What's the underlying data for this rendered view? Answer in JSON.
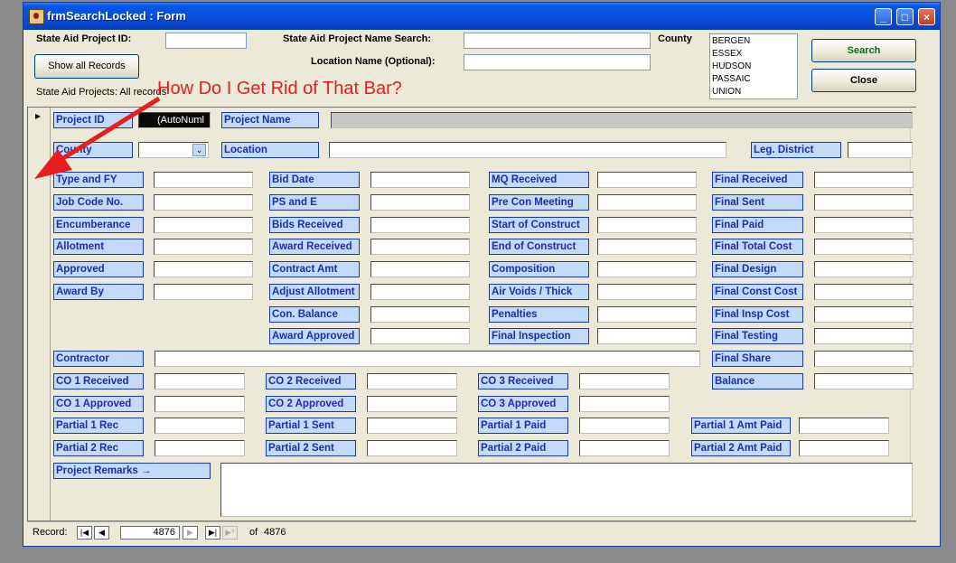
{
  "window": {
    "title": "frmSearchLocked : Form"
  },
  "header": {
    "project_id_label": "State Aid Project ID:",
    "project_name_search_label": "State Aid Project Name Search:",
    "location_label": "Location Name (Optional):",
    "county_label": "County",
    "show_all_label": "Show all Records",
    "search_label": "Search",
    "close_label": "Close",
    "status_text": "State Aid Projects: All records",
    "county_options": [
      "BERGEN",
      "ESSEX",
      "HUDSON",
      "PASSAIC",
      "UNION"
    ]
  },
  "annotation": "How Do I Get Rid of That Bar?",
  "record_selector": "▸",
  "fields": {
    "project_id": "Project ID",
    "project_id_value": "(AutoNuml",
    "project_name": "Project Name",
    "county": "County",
    "location": "Location",
    "leg_district": "Leg. District",
    "col1": [
      "Type and FY",
      "Job Code No.",
      "Encumberance",
      "Allotment",
      "Approved",
      "Award By"
    ],
    "col2": [
      "Bid Date",
      "PS and E",
      "Bids Received",
      "Award Received",
      "Contract Amt",
      "Adjust Allotment",
      "Con. Balance",
      "Award Approved"
    ],
    "col3": [
      "MQ Received",
      "Pre Con Meeting",
      "Start of Construct",
      "End of Construct",
      "Composition",
      "Air Voids / Thick",
      "Penalties",
      "Final Inspection"
    ],
    "col4": [
      "Final Received",
      "Final Sent",
      "Final Paid",
      "Final Total Cost",
      "Final Design",
      "Final Const Cost",
      "Final Insp Cost",
      "Final Testing",
      "Final Share",
      "Balance"
    ],
    "contractor": "Contractor",
    "co_row1": [
      "CO 1 Received",
      "CO 2 Received",
      "CO 3 Received"
    ],
    "co_row2": [
      "CO 1 Approved",
      "CO 2 Approved",
      "CO 3 Approved"
    ],
    "partial_row1": [
      "Partial 1 Rec",
      "Partial 1 Sent",
      "Partial 1 Paid",
      "Partial 1 Amt Paid"
    ],
    "partial_row2": [
      "Partial 2 Rec",
      "Partial 2 Sent",
      "Partial 2 Paid",
      "Partial 2 Amt Paid"
    ],
    "project_remarks": "Project Remarks →"
  },
  "navigation": {
    "record_label": "Record:",
    "current_record": "4876",
    "of_label": "of",
    "total_records": "4876",
    "first_icon": "first-record-icon",
    "prev_icon": "previous-record-icon",
    "next_icon": "next-record-icon",
    "last_icon": "last-record-icon",
    "new_icon": "new-record-icon"
  },
  "colors": {
    "label_bg": "#c4dafa",
    "label_text": "#1a2fa8",
    "annotation": "#e61e1e",
    "title_bar": "#0a4fd8"
  }
}
